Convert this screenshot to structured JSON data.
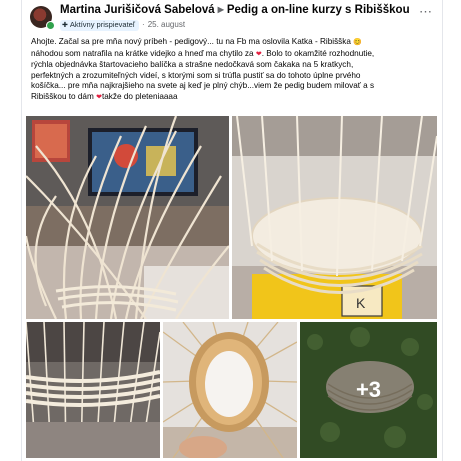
{
  "post": {
    "author": "Martina Jurišičová Sabelová",
    "group": "Pedig a on-line kurzy s Ribišškou",
    "badge": "Aktívny prispievateľ",
    "date": "25. august",
    "separator": "·",
    "text_lines": [
      "Ahojte. Začal sa pre mňa nový príbeh - pedigový... tu na Fb ma oslovila Katka - Ribišška",
      "náhodou som natrafila na krátke videjko  a hneď ma chytilo za",
      "rýchla objednávka štartovacieho balíčka a strašne nedočkavá som čakaka na 5 kratkych,",
      "perfektných a zrozumiteľných videí, s ktorými som si trúfla pustiť sa do tohoto úplne prvého",
      "košíčka... pre mňa najkrajšieho na svete aj keď je plný chýb...viem že pedig budem milovať a s",
      "Ribišškou to dám",
      "takže do pleteniaaaa"
    ],
    "text_after_heart": ". Bolo to okamžité rozhodnutie,",
    "more_count": "+3"
  },
  "icons": {
    "avatar": "avatar-photo",
    "badge": "badge-icon",
    "menu": "more-options-icon",
    "heart": "red-heart-emoji",
    "smile": "smiling-face-emoji"
  },
  "colors": {
    "text": "#050505",
    "secondary": "#65676b",
    "badge_bg": "#e7f3ff",
    "heart": "#e41e3f"
  }
}
